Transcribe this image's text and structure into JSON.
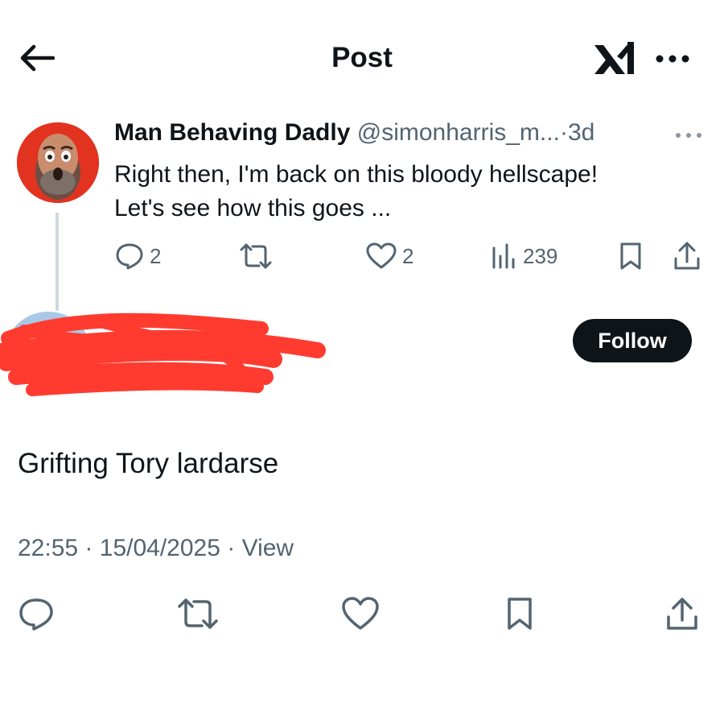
{
  "header": {
    "title": "Post",
    "back_icon": "arrow-left-icon",
    "brand_icon": "xai-logo-icon",
    "more_icon": "more-horizontal-icon"
  },
  "parent_post": {
    "author_name": "Man Behaving Dadly",
    "handle": "@simonharris_m...",
    "separator": "·",
    "age": "3d",
    "text_lines": [
      "Right then, I'm back on this bloody hellscape!",
      "Let's see how this goes ..."
    ],
    "metrics": {
      "replies": "2",
      "likes": "2",
      "views": "239"
    }
  },
  "reply": {
    "author_redacted": true,
    "follow_label": "Follow",
    "text": "Grifting Tory lardarse",
    "time": "22:55",
    "date": "15/04/2025",
    "sep": "·",
    "view_label": "View"
  },
  "colors": {
    "text": "#0f1419",
    "secondary": "#536471",
    "redaction": "#ff3b30",
    "avatar_bg": "#e1331f",
    "thread_line": "#cfd9de"
  }
}
